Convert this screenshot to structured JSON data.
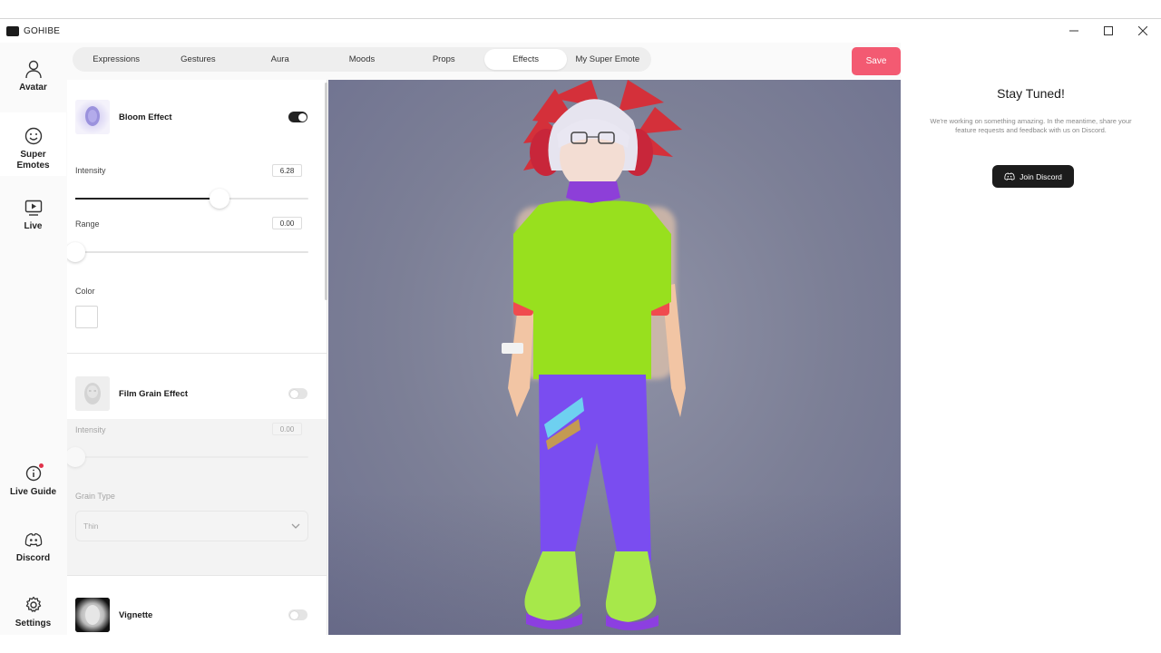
{
  "app": {
    "title": "GOHIBE",
    "logo_text": "GOHIBE"
  },
  "window_controls": {
    "minimize": "—",
    "maximize": "□",
    "close": "✕"
  },
  "sidebar": {
    "items": [
      {
        "label": "Avatar",
        "icon": "person-icon"
      },
      {
        "label": "Super Emotes",
        "icon": "smiley-icon",
        "active": true
      },
      {
        "label": "Live",
        "icon": "play-screen-icon"
      },
      {
        "label": "Live Guide",
        "icon": "info-icon",
        "notification": true
      },
      {
        "label": "Discord",
        "icon": "discord-icon"
      },
      {
        "label": "Settings",
        "icon": "gear-icon"
      }
    ]
  },
  "tabs": [
    {
      "label": "Expressions"
    },
    {
      "label": "Gestures"
    },
    {
      "label": "Aura"
    },
    {
      "label": "Moods"
    },
    {
      "label": "Props"
    },
    {
      "label": "Effects",
      "active": true
    },
    {
      "label": "My Super Emote"
    }
  ],
  "save_label": "Save",
  "effects": {
    "bloom": {
      "name": "Bloom Effect",
      "enabled": true,
      "intensity_label": "Intensity",
      "intensity_value": "6.28",
      "intensity_fraction": 0.62,
      "range_label": "Range",
      "range_value": "0.00",
      "range_fraction": 0.0,
      "color_label": "Color",
      "color_value": "#ffffff"
    },
    "film_grain": {
      "name": "Film Grain Effect",
      "enabled": false,
      "intensity_label": "Intensity",
      "intensity_value": "0.00",
      "intensity_fraction": 0.0,
      "grain_type_label": "Grain Type",
      "grain_type_value": "Thin"
    },
    "vignette": {
      "name": "Vignette",
      "enabled": false
    }
  },
  "right_panel": {
    "title": "Stay Tuned!",
    "text": "We're working on something amazing. In the meantime, share your feature requests and feedback with us on Discord.",
    "button_label": "Join Discord"
  },
  "colors": {
    "accent": "#f35a72",
    "dark": "#1c1c1c",
    "viewport_bg": "#7c7f96"
  }
}
